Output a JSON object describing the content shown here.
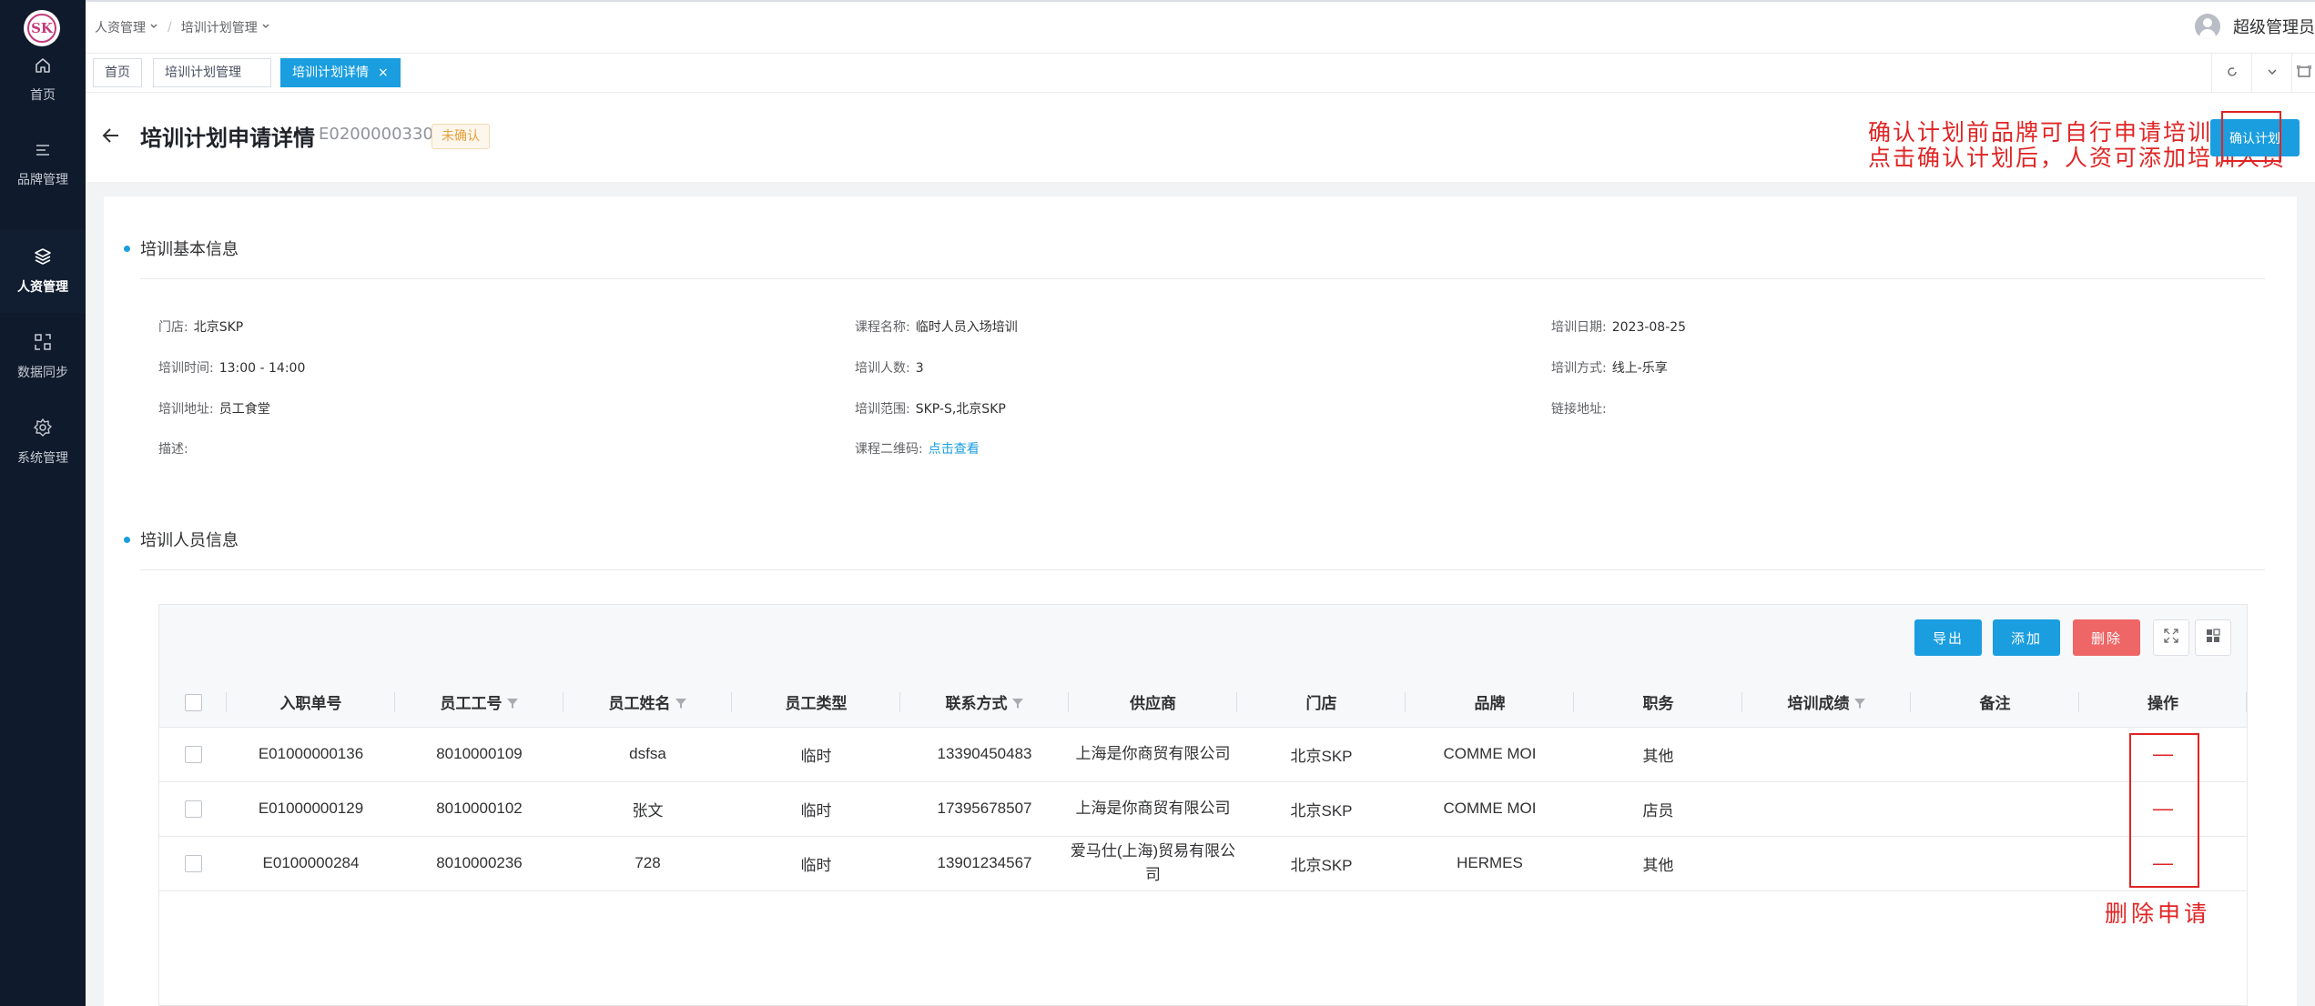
{
  "sidebar": {
    "logo_text": "SKP",
    "items": [
      {
        "label": "首页",
        "icon": "home-icon",
        "active": false
      },
      {
        "label": "品牌管理",
        "icon": "list-icon",
        "active": false
      },
      {
        "label": "人资管理",
        "icon": "layers-icon",
        "active": true
      },
      {
        "label": "数据同步",
        "icon": "sync-icon",
        "active": false
      },
      {
        "label": "系统管理",
        "icon": "gear-icon",
        "active": false
      }
    ]
  },
  "header": {
    "breadcrumb": [
      "人资管理",
      "培训计划管理"
    ],
    "user": "超级管理员"
  },
  "tabs": [
    {
      "label": "首页",
      "active": false
    },
    {
      "label": "培训计划管理",
      "active": false
    },
    {
      "label": "培训计划详情",
      "active": true,
      "close": "×"
    }
  ],
  "page": {
    "title": "培训计划申请详情",
    "code": "E0200000330",
    "status": "未确认",
    "confirm_button": "确认计划",
    "annotation_line1": "确认计划前品牌可自行申请培训，",
    "annotation_line2": "点击确认计划后，人资可添加培训人员"
  },
  "basic": {
    "section_title": "培训基本信息",
    "fields": [
      {
        "label": "门店:",
        "value": "北京SKP"
      },
      {
        "label": "课程名称:",
        "value": "临时人员入场培训"
      },
      {
        "label": "培训日期:",
        "value": "2023-08-25"
      },
      {
        "label": "培训时间:",
        "value": "13:00 - 14:00"
      },
      {
        "label": "培训人数:",
        "value": "3"
      },
      {
        "label": "培训方式:",
        "value": "线上-乐享"
      },
      {
        "label": "培训地址:",
        "value": "员工食堂"
      },
      {
        "label": "培训范围:",
        "value": "SKP-S,北京SKP"
      },
      {
        "label": "链接地址:",
        "value": ""
      },
      {
        "label": "描述:",
        "value": ""
      },
      {
        "label": "课程二维码:",
        "link": "点击查看"
      }
    ]
  },
  "people": {
    "section_title": "培训人员信息",
    "buttons": {
      "export": "导出",
      "add": "添加",
      "delete": "删除"
    },
    "columns": [
      "入职单号",
      "员工工号",
      "员工姓名",
      "员工类型",
      "联系方式",
      "供应商",
      "门店",
      "品牌",
      "职务",
      "培训成绩",
      "备注",
      "操作"
    ],
    "rows": [
      [
        "E01000000136",
        "8010000109",
        "dsfsa",
        "临时",
        "13390450483",
        "上海是你商贸有限公司",
        "北京SKP",
        "COMME MOI",
        "其他",
        "",
        "",
        "—"
      ],
      [
        "E01000000129",
        "8010000102",
        "张文",
        "临时",
        "17395678507",
        "上海是你商贸有限公司",
        "北京SKP",
        "COMME MOI",
        "店员",
        "",
        "",
        "—"
      ],
      [
        "E0100000284",
        "8010000236",
        "728",
        "临时",
        "13901234567",
        "爱马仕(上海)贸易有限公司",
        "北京SKP",
        "HERMES",
        "其他",
        "",
        "",
        "—"
      ]
    ],
    "annotation_delete": "删除申请"
  },
  "colors": {
    "primary": "#1a9ee0",
    "danger": "#ee6666",
    "annotation": "#e02424",
    "sidebar": "#0f1a2c"
  }
}
